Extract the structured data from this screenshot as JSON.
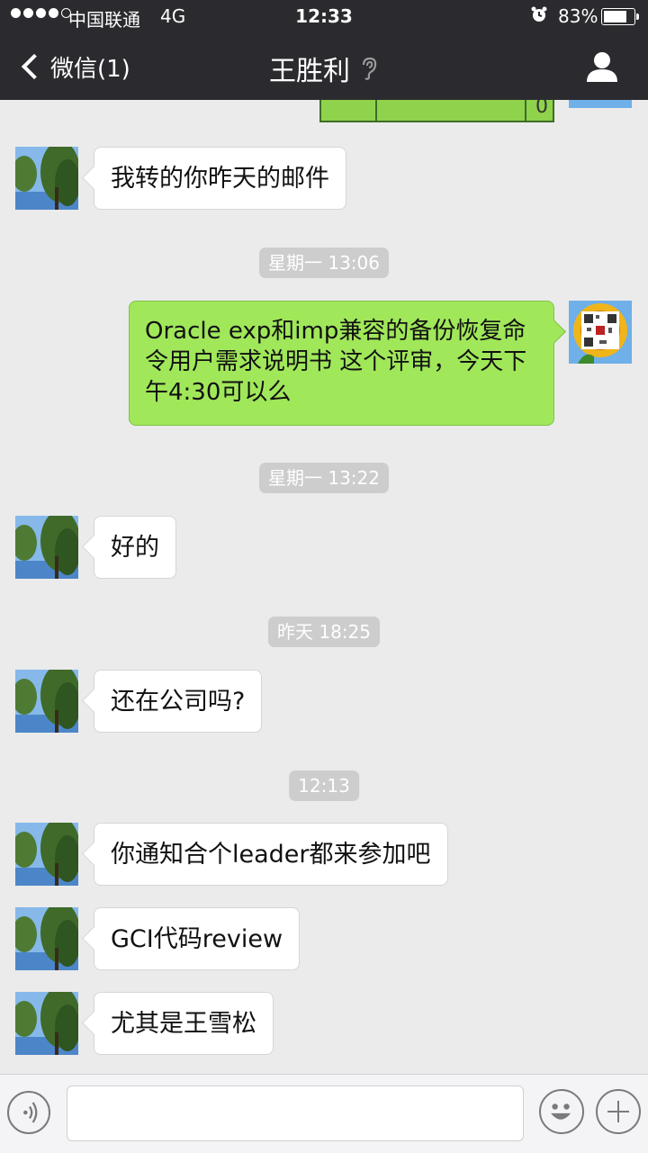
{
  "status_bar": {
    "carrier": "中国联通",
    "network": "4G",
    "time": "12:33",
    "battery_text": "83%",
    "battery_level": 0.83,
    "signal_bars_filled": 4,
    "signal_bars_total": 5
  },
  "nav": {
    "back_label": "微信(1)",
    "title": "王胜利",
    "icons": [
      "chevron-left-icon",
      "ear-icon",
      "person-icon"
    ]
  },
  "partial_image": {
    "cell_text": "0"
  },
  "messages": [
    {
      "side": "in",
      "text": "我转的你昨天的邮件"
    },
    {
      "type": "time",
      "text": "星期一 13:06"
    },
    {
      "side": "out",
      "text": "Oracle exp和imp兼容的备份恢复命令用户需求说明书 这个评审，今天下午4:30可以么"
    },
    {
      "type": "time",
      "text": "星期一 13:22"
    },
    {
      "side": "in",
      "text": "好的"
    },
    {
      "type": "time",
      "text": "昨天 18:25"
    },
    {
      "side": "in",
      "text": "还在公司吗?"
    },
    {
      "type": "time",
      "text": "12:13"
    },
    {
      "side": "in",
      "text": "你通知合个leader都来参加吧"
    },
    {
      "side": "in",
      "text": "GCI代码review"
    },
    {
      "side": "in",
      "text": "尤其是王雪松"
    }
  ],
  "input_bar": {
    "placeholder": "",
    "icons": [
      "voice-icon",
      "emoji-icon",
      "plus-icon"
    ]
  },
  "colors": {
    "nav_bg": "#2b2b2f",
    "chat_bg": "#ebebeb",
    "sent_bubble": "#a0e75a",
    "received_bubble": "#ffffff",
    "time_chip": "#cdcdcd"
  }
}
